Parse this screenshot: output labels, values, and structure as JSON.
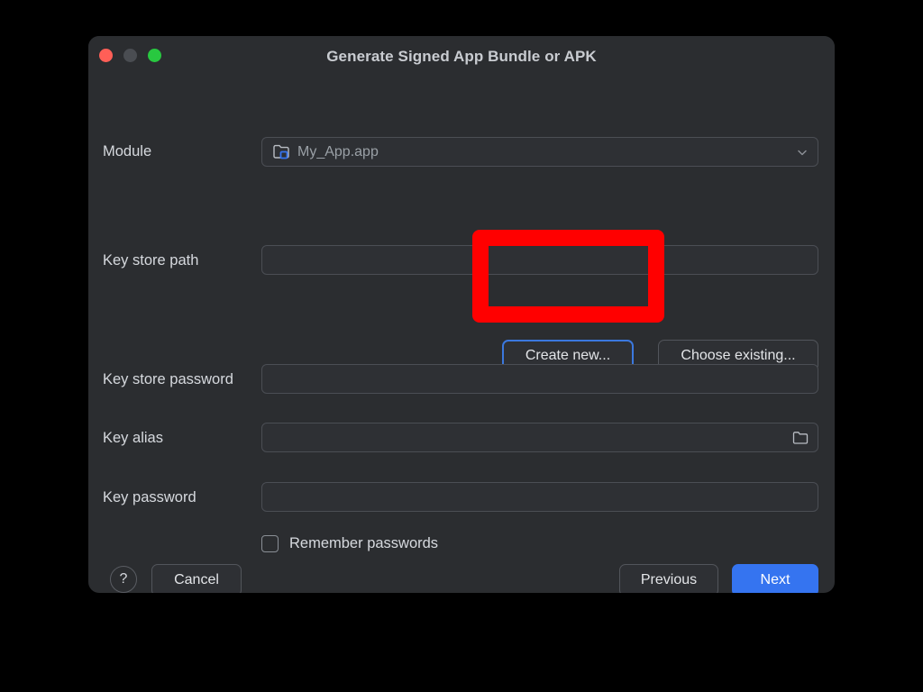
{
  "window": {
    "title": "Generate Signed App Bundle or APK",
    "traffic_lights": [
      {
        "name": "close",
        "color": "#ff5f57"
      },
      {
        "name": "minimize",
        "color": "#4a4d52"
      },
      {
        "name": "zoom",
        "color": "#28c840"
      }
    ]
  },
  "form": {
    "module": {
      "label": "Module",
      "value": "My_App.app",
      "icon": "module-folder-icon",
      "chevron": "chevron-down-icon"
    },
    "key_store_path": {
      "label": "Key store path",
      "value": "",
      "placeholder": ""
    },
    "key_store_password": {
      "label": "Key store password",
      "value": "",
      "placeholder": ""
    },
    "key_alias": {
      "label": "Key alias",
      "value": "",
      "placeholder": "",
      "icon": "folder-icon"
    },
    "key_password": {
      "label": "Key password",
      "value": "",
      "placeholder": ""
    },
    "remember_passwords": {
      "label": "Remember passwords",
      "checked": false
    }
  },
  "buttons": {
    "create_new": "Create new...",
    "choose_existing": "Choose existing...",
    "help": "?",
    "cancel": "Cancel",
    "previous": "Previous",
    "next": "Next"
  },
  "annotation": {
    "type": "highlight-rectangle",
    "color": "#ff0000",
    "target": "create-new-button"
  },
  "colors": {
    "dialog_background": "#2b2d30",
    "field_background": "#2e3034",
    "field_border": "#4b4e54",
    "accent_blue": "#3574f0",
    "focus_blue": "#3b78de",
    "text_primary": "#d6d9de",
    "text_muted": "#9aa0a6",
    "highlight_red": "#ff0000",
    "desktop_background": "#000000"
  }
}
